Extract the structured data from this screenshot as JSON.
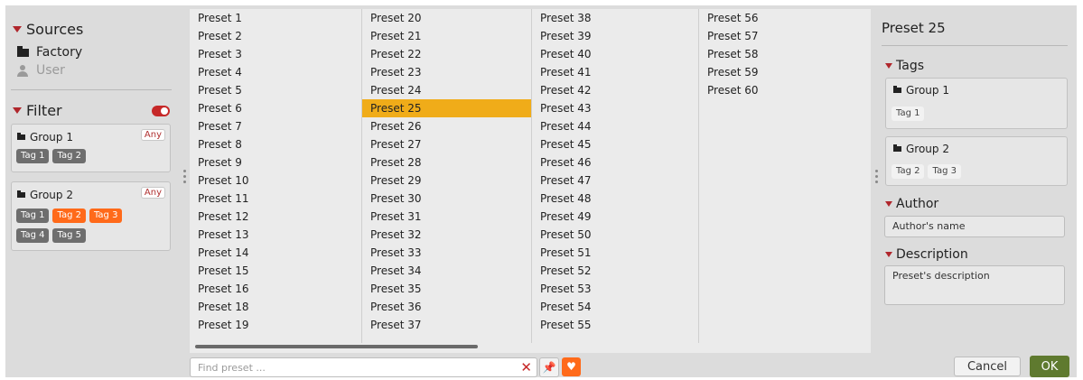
{
  "sources": {
    "title": "Sources",
    "items": [
      {
        "label": "Factory",
        "icon": "folder-icon",
        "active": true
      },
      {
        "label": "User",
        "icon": "user-icon",
        "active": false
      }
    ]
  },
  "filter": {
    "title": "Filter",
    "enabled": true,
    "groups": [
      {
        "name": "Group 1",
        "any_label": "Any",
        "tags": [
          {
            "label": "Tag 1",
            "on": false
          },
          {
            "label": "Tag 2",
            "on": false
          }
        ]
      },
      {
        "name": "Group 2",
        "any_label": "Any",
        "tags": [
          {
            "label": "Tag 1",
            "on": false
          },
          {
            "label": "Tag 2",
            "on": true
          },
          {
            "label": "Tag 3",
            "on": true
          },
          {
            "label": "Tag 4",
            "on": false
          },
          {
            "label": "Tag 5",
            "on": false
          }
        ]
      }
    ]
  },
  "presets": {
    "columns": [
      [
        "Preset 1",
        "Preset 2",
        "Preset 3",
        "Preset 4",
        "Preset 5",
        "Preset 6",
        "Preset 7",
        "Preset 8",
        "Preset 9",
        "Preset 10",
        "Preset 11",
        "Preset 12",
        "Preset 13",
        "Preset 14",
        "Preset 15",
        "Preset 16",
        "Preset 18",
        "Preset 19"
      ],
      [
        "Preset 20",
        "Preset 21",
        "Preset 22",
        "Preset 23",
        "Preset 24",
        "Preset 25",
        "Preset 26",
        "Preset 27",
        "Preset 28",
        "Preset 29",
        "Preset 30",
        "Preset 31",
        "Preset 32",
        "Preset 33",
        "Preset 34",
        "Preset 35",
        "Preset 36",
        "Preset 37"
      ],
      [
        "Preset 38",
        "Preset 39",
        "Preset 40",
        "Preset 41",
        "Preset 42",
        "Preset 43",
        "Preset 44",
        "Preset 45",
        "Preset 46",
        "Preset 47",
        "Preset 48",
        "Preset 49",
        "Preset 50",
        "Preset 51",
        "Preset 52",
        "Preset 53",
        "Preset 54",
        "Preset 55"
      ],
      [
        "Preset 56",
        "Preset 57",
        "Preset 58",
        "Preset 59",
        "Preset 60"
      ]
    ],
    "selected": "Preset 25"
  },
  "search": {
    "placeholder": "Find preset ...",
    "value": "",
    "clear_symbol": "✕"
  },
  "toolbar": {
    "pin_symbol": "📌",
    "favorite_symbol": "♥"
  },
  "details": {
    "title": "Preset 25",
    "tags_title": "Tags",
    "groups": [
      {
        "name": "Group 1",
        "tags": [
          "Tag 1"
        ]
      },
      {
        "name": "Group 2",
        "tags": [
          "Tag 2",
          "Tag 3"
        ]
      }
    ],
    "author_title": "Author",
    "author_value": "Author's name",
    "description_title": "Description",
    "description_value": "Preset's description"
  },
  "buttons": {
    "cancel": "Cancel",
    "ok": "OK"
  },
  "colors": {
    "accent_red": "#c62828",
    "tag_orange": "#ff6a1a",
    "selection": "#f0ac19",
    "ok_green": "#5f7a2f"
  }
}
